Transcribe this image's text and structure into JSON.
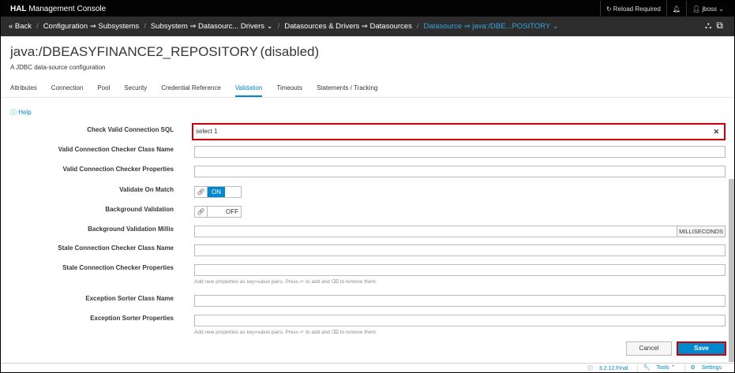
{
  "topbar": {
    "brand_bold": "HAL",
    "brand_rest": " Management Console",
    "reload": "Reload Required",
    "bell": "🔔",
    "user": "jboss"
  },
  "nav": {
    "back": "« Back",
    "crumbs": [
      "Configuration ⇒ Subsystems",
      "Subsystem ⇒ Datasourc... Drivers ⌄",
      "Datasources & Drivers ⇒ Datasources"
    ],
    "active": "Datasource ⇒ java:/DBE...POSITORY ⌄"
  },
  "page": {
    "title": "java:/DBEASYFINANCE2_REPOSITORY",
    "status": "(disabled)",
    "subtitle": "A JDBC data-source configuration"
  },
  "tabs": [
    "Attributes",
    "Connection",
    "Pool",
    "Security",
    "Credential Reference",
    "Validation",
    "Timeouts",
    "Statements / Tracking"
  ],
  "help": "Help",
  "form": {
    "check_sql_label": "Check Valid Connection SQL",
    "check_sql_value": "select 1",
    "checker_class_label": "Valid Connection Checker Class Name",
    "checker_props_label": "Valid Connection Checker Properties",
    "validate_match_label": "Validate On Match",
    "validate_match_state": "ON",
    "bg_validation_label": "Background Validation",
    "bg_validation_state": "OFF",
    "bg_millis_label": "Background Validation Millis",
    "bg_millis_unit": "MILLISECONDS",
    "stale_class_label": "Stale Connection Checker Class Name",
    "stale_props_label": "Stale Connection Checker Properties",
    "kv_hint": "Add new properties as key=value pairs. Press ↵ to add and ⌫ to remove them.",
    "sorter_class_label": "Exception Sorter Class Name",
    "sorter_props_label": "Exception Sorter Properties"
  },
  "buttons": {
    "cancel": "Cancel",
    "save": "Save"
  },
  "footer": {
    "version": "3.2.12.Final",
    "tools": "Tools ⌃",
    "settings": "Settings"
  }
}
